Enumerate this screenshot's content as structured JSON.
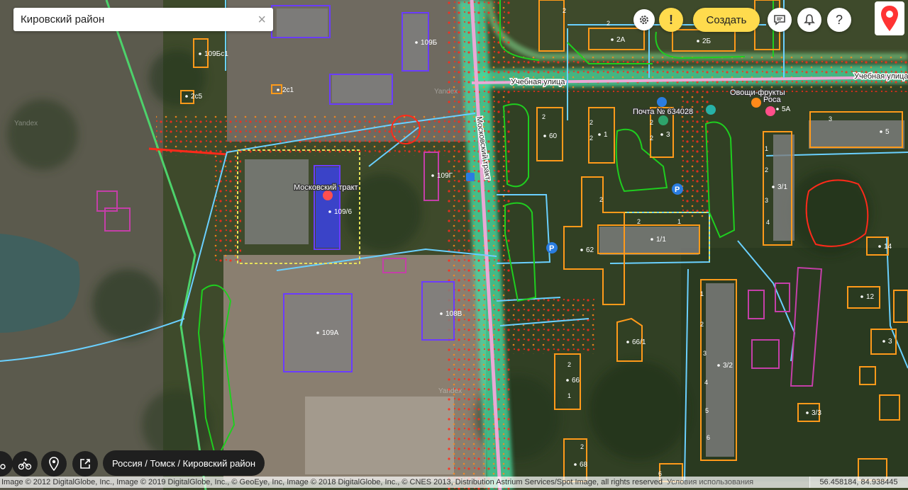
{
  "search": {
    "value": "Кировский район"
  },
  "toolbar": {
    "create_label": "Создать",
    "warn_label": "!",
    "help_label": "?"
  },
  "labels": {
    "road_uchebnaya": "Учебная улица",
    "road_uchebnaya_2": "Учебная улица",
    "road_moskovsky": "Московский тракт",
    "stop_moskovsky": "Московский тракт",
    "post": "Почта № 634028",
    "shop_veg": "Овощи-фрукты",
    "shop_rosa": "Роса",
    "watermark": "Yandex"
  },
  "buildings": {
    "b109b": "109Б",
    "b109bc1": "109Бс1",
    "b2c5": "2с5",
    "b2c1": "2с1",
    "b109v": "109/6",
    "b109g": "109Г",
    "b109a": "109А",
    "b108v": "108В",
    "b2a": "2А",
    "b2b": "2Б",
    "b5a": "5А",
    "b60": "60",
    "b1": "1",
    "b3": "3",
    "b5": "5",
    "b3_1": "3/1",
    "b1_1": "1/1",
    "b62": "62",
    "b14": "14",
    "b12": "12",
    "b3r": "3",
    "b66_1": "66/1",
    "b3_2": "3/2",
    "b66": "66",
    "b68": "68",
    "b3_3": "3/3",
    "b6": "6",
    "entr2": "2",
    "entr1": "1",
    "entr3": "3",
    "entr4": "4",
    "entr5": "5",
    "entr6": "6"
  },
  "breadcrumb": "Россия / Томск / Кировский район",
  "copyright": "Image © 2012 DigitalGlobe, Inc., Image © 2019 DigitalGlobe, Inc., © GeoEye, Inc, Image © 2018 DigitalGlobe, Inc., © CNES 2013, Distribution Astrium Services/Spot Image, all rights reserved",
  "terms": "Условия использования",
  "coords": "56.458184, 84.938445",
  "icons": [
    "search-clear-icon",
    "gear-icon",
    "warning-icon",
    "chat-icon",
    "bell-icon",
    "help-icon",
    "yandex-maps-logo",
    "cyclist-icon",
    "location-pin-icon",
    "share-icon",
    "bus-stop-icon",
    "parking-icon",
    "mail-icon",
    "shop-icon"
  ],
  "colors": {
    "road_green": "#4dd26b",
    "road_pink": "#e9a9d6",
    "traffic_red": "#ff2a1a",
    "boundary_orange": "#ff9a1a",
    "boundary_purple": "#6a3cff",
    "zone_yellow": "#e6e05a",
    "park_green": "#1fce1f",
    "path_blue": "#6ad0ff",
    "accent_yellow": "#ffdb4d"
  }
}
